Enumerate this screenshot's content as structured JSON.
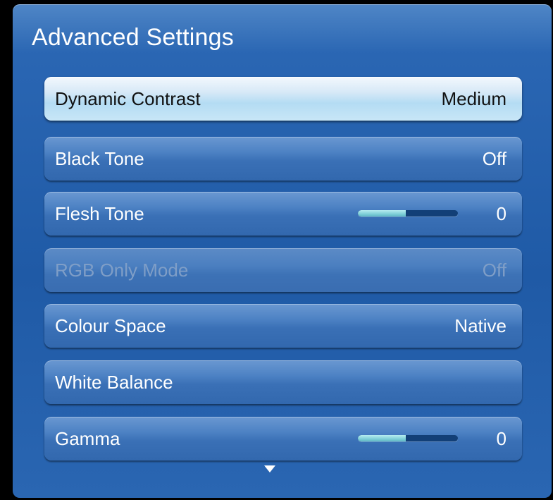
{
  "panel": {
    "title": "Advanced Settings"
  },
  "rows": [
    {
      "label": "Dynamic Contrast",
      "value": "Medium",
      "state": "focused"
    },
    {
      "label": "Black Tone",
      "value": "Off",
      "state": "normal"
    },
    {
      "label": "Flesh Tone",
      "value": "0",
      "state": "normal",
      "slider_fraction": 0.48
    },
    {
      "label": "RGB Only Mode",
      "value": "Off",
      "state": "disabled"
    },
    {
      "label": "Colour Space",
      "value": "Native",
      "state": "normal"
    },
    {
      "label": "White Balance",
      "value": "",
      "state": "normal"
    },
    {
      "label": "Gamma",
      "value": "0",
      "state": "normal",
      "slider_fraction": 0.48
    }
  ],
  "scroll_indicator": "down-arrow-icon",
  "colors": {
    "panel_blue": "#2a66b3",
    "focus_highlight": "#b4dcf3",
    "slider_fill": "#7fcfd8",
    "slider_track": "#123f77"
  }
}
